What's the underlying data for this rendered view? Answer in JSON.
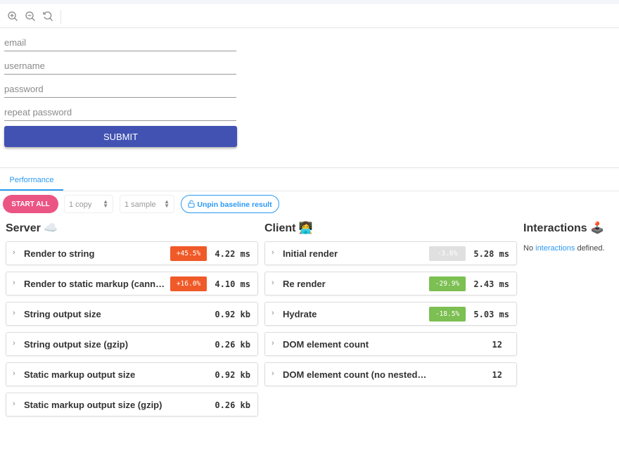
{
  "toolbar": {
    "icons": [
      "zoom-in-icon",
      "zoom-out-icon",
      "reset-zoom-icon"
    ]
  },
  "form": {
    "email_placeholder": "email",
    "username_placeholder": "username",
    "password_placeholder": "password",
    "repeat_password_placeholder": "repeat password",
    "submit_label": "SUBMIT"
  },
  "tabs": [
    {
      "label": "Performance",
      "active": true
    }
  ],
  "controls": {
    "start_all": "START ALL",
    "copies": "1 copy",
    "samples": "1 sample",
    "unpin": "Unpin baseline result"
  },
  "server": {
    "title": "Server ☁️",
    "rows": [
      {
        "label": "Render to string",
        "badge": "+45.5%",
        "value": "4.22 ms"
      },
      {
        "label": "Render to static markup (cannot hydrate)",
        "badge": "+16.0%",
        "value": "4.10 ms"
      },
      {
        "label": "String output size",
        "badge": null,
        "value": "0.92 kb"
      },
      {
        "label": "String output size (gzip)",
        "badge": null,
        "value": "0.26 kb"
      },
      {
        "label": "Static markup output size",
        "badge": null,
        "value": "0.92 kb"
      },
      {
        "label": "Static markup output size (gzip)",
        "badge": null,
        "value": "0.26 kb"
      }
    ]
  },
  "client": {
    "title": "Client 👩‍💻",
    "rows": [
      {
        "label": "Initial render",
        "badge": "-3.6%",
        "value": "5.28 ms"
      },
      {
        "label": "Re render",
        "badge": "-29.9%",
        "value": "2.43 ms"
      },
      {
        "label": "Hydrate",
        "badge": "-18.5%",
        "value": "5.03 ms"
      },
      {
        "label": "DOM element count",
        "badge": null,
        "value": "12"
      },
      {
        "label": "DOM element count (no nested inline svg elements)",
        "badge": null,
        "value": "12"
      }
    ]
  },
  "interactions": {
    "title": "Interactions 🕹️",
    "text_before": "No ",
    "link": "interactions",
    "text_after": " defined."
  },
  "colors": {
    "accent": "#2b9af3",
    "submit": "#4152b3",
    "start": "#eb5584",
    "badge_worse": "#f05a28",
    "badge_better": "#7cbf52",
    "badge_neutral": "#e0e0e0"
  }
}
